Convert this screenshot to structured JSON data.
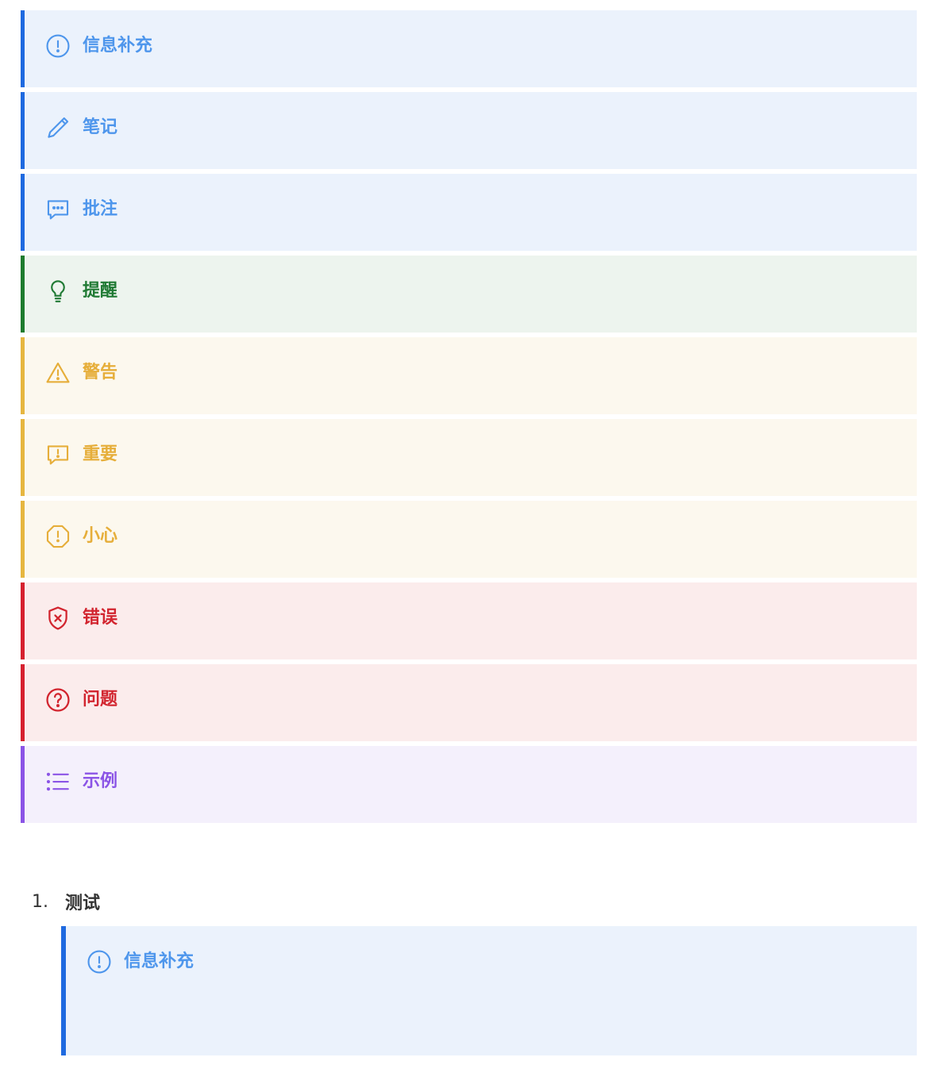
{
  "callouts": [
    {
      "type": "info",
      "title": "信息补充",
      "icon": "info-circle-icon",
      "color": "#4e96ec"
    },
    {
      "type": "note",
      "title": "笔记",
      "icon": "pencil-icon",
      "color": "#4e96ec"
    },
    {
      "type": "comment",
      "title": "批注",
      "icon": "comment-dots-icon",
      "color": "#4e96ec"
    },
    {
      "type": "tip",
      "title": "提醒",
      "icon": "lightbulb-icon",
      "color": "#207a34"
    },
    {
      "type": "warning",
      "title": "警告",
      "icon": "warning-triangle-icon",
      "color": "#e6ae3a"
    },
    {
      "type": "important",
      "title": "重要",
      "icon": "comment-alert-icon",
      "color": "#e6ae3a"
    },
    {
      "type": "caution",
      "title": "小心",
      "icon": "octagon-alert-icon",
      "color": "#e6ae3a"
    },
    {
      "type": "error",
      "title": "错误",
      "icon": "shield-x-icon",
      "color": "#d2252f"
    },
    {
      "type": "question",
      "title": "问题",
      "icon": "question-circle-icon",
      "color": "#d2252f"
    },
    {
      "type": "example",
      "title": "示例",
      "icon": "list-icon",
      "color": "#8b54e6"
    }
  ],
  "ordered_list": {
    "items": [
      {
        "number": "1.",
        "label": "测试",
        "callout": {
          "type": "info",
          "title": "信息补充",
          "icon": "info-circle-icon"
        }
      }
    ]
  }
}
